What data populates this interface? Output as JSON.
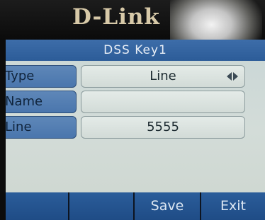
{
  "brand": {
    "logo_text": "D-Link"
  },
  "screen": {
    "title": "DSS Key1"
  },
  "fields": [
    {
      "label": "Type",
      "value": "Line",
      "has_arrows": true
    },
    {
      "label": "Name",
      "value": ""
    },
    {
      "label": "Line",
      "value": "5555"
    }
  ],
  "softkeys": [
    {
      "label": ""
    },
    {
      "label": ""
    },
    {
      "label": "Save"
    },
    {
      "label": "Exit"
    }
  ],
  "icons": {
    "type_selector": "left-right-arrows-icon"
  }
}
